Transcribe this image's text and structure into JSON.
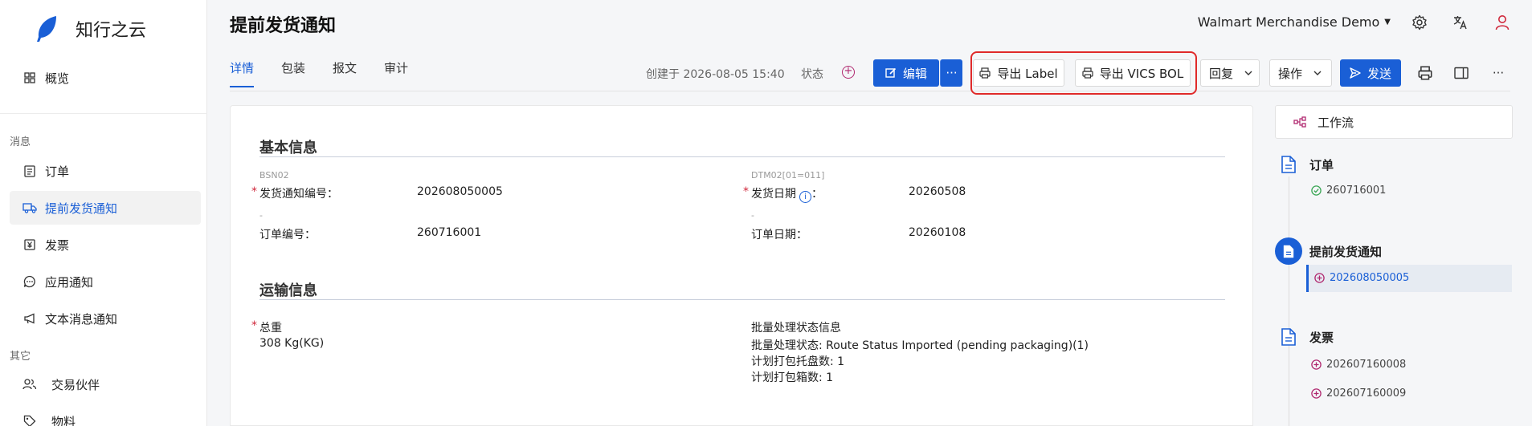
{
  "app": {
    "name": "知行之云"
  },
  "sidebar": {
    "overview": "概览",
    "group_messages": "消息",
    "items": [
      {
        "label": "订单"
      },
      {
        "label": "提前发货通知"
      },
      {
        "label": "发票"
      },
      {
        "label": "应用通知"
      },
      {
        "label": "文本消息通知"
      }
    ],
    "group_other": "其它",
    "other_items": [
      {
        "label": "交易伙伴"
      },
      {
        "label": "物料"
      }
    ]
  },
  "header": {
    "title": "提前发货通知",
    "org": "Walmart Merchandise Demo"
  },
  "tabs": [
    "详情",
    "包装",
    "报文",
    "审计"
  ],
  "meta": {
    "created": "创建于 2026-08-05 15:40",
    "status_label": "状态"
  },
  "toolbar": {
    "edit": "编辑",
    "more": "···",
    "export_label": "导出 Label",
    "export_vics": "导出 VICS BOL",
    "reply": "回复",
    "actions": "操作",
    "send": "发送",
    "overflow": "···"
  },
  "basic": {
    "title": "基本信息",
    "code_left": "BSN02",
    "code_right": "DTM02[01=011]",
    "asn_label": "发货通知编号：",
    "asn_value": "202608050005",
    "ship_date_label": "发货日期",
    "ship_date_colon": "：",
    "ship_date_value": "20260508",
    "dash_left": "-",
    "dash_right": "-",
    "order_no_label": "订单编号：",
    "order_no_value": "260716001",
    "order_date_label": "订单日期：",
    "order_date_value": "20260108"
  },
  "transport": {
    "title": "运输信息",
    "weight_label": "总重",
    "weight_value": "308 Kg(KG)",
    "batch_title": "批量处理状态信息",
    "batch_status": "批量处理状态: Route Status Imported (pending packaging)(1)",
    "pallets": "计划打包托盘数: 1",
    "cartons": "计划打包箱数: 1"
  },
  "workflow": {
    "title": "工作流",
    "steps": [
      {
        "title": "订单",
        "links": [
          "260716001"
        ]
      },
      {
        "title": "提前发货通知",
        "links": [
          "202608050005"
        ]
      },
      {
        "title": "发票",
        "links": [
          "202607160008",
          "202607160009"
        ]
      }
    ]
  },
  "colors": {
    "accent": "#1a5fd6",
    "highlight": "#e02a2a",
    "required": "#d0283c",
    "success": "#3aa655",
    "magenta": "#b0286f"
  }
}
